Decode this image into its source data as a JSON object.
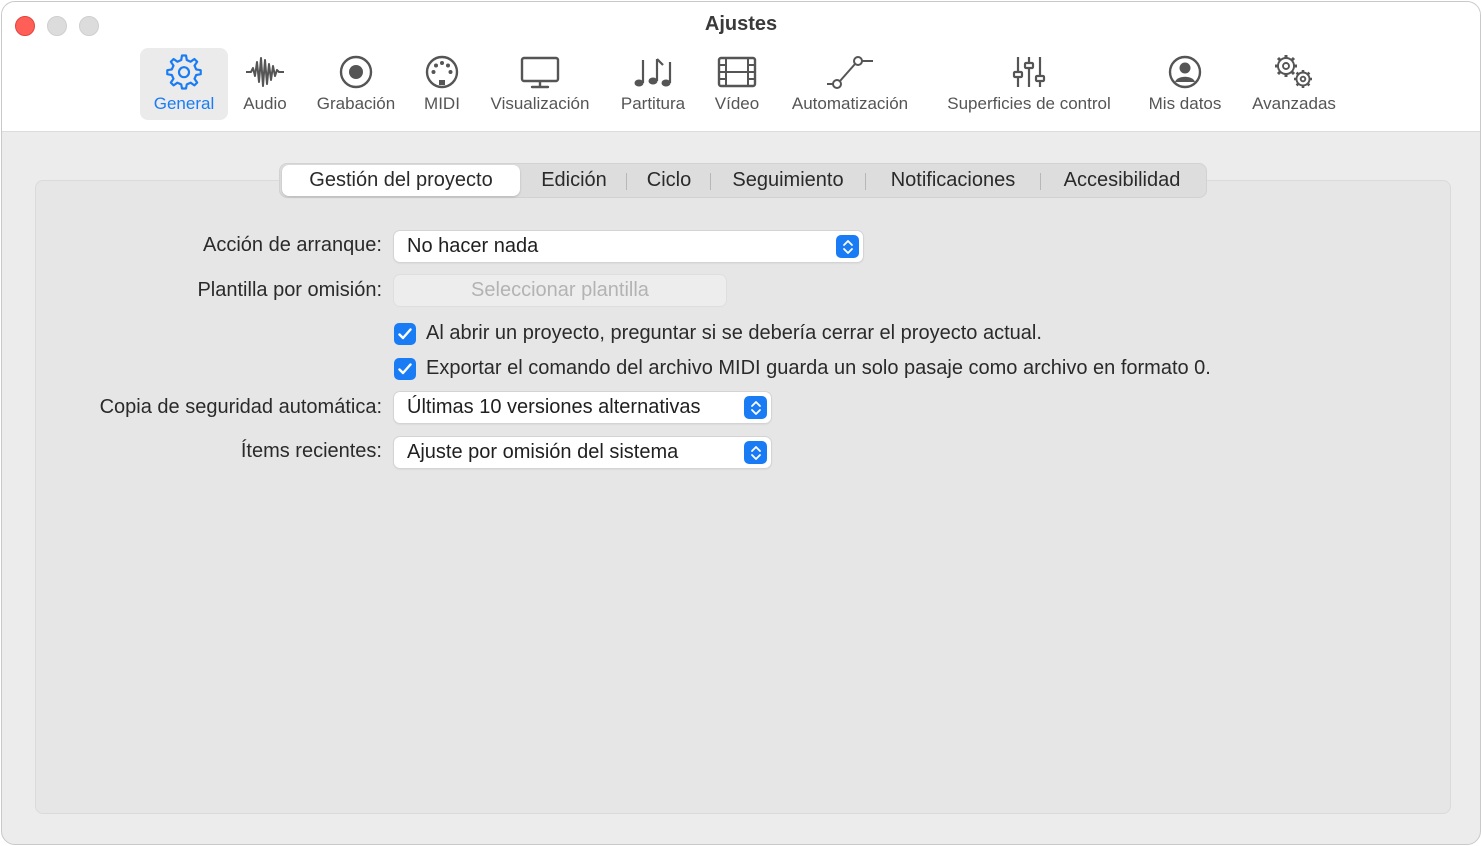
{
  "window": {
    "title": "Ajustes"
  },
  "toolbar": {
    "items": [
      {
        "label": "General",
        "icon": "gear-icon",
        "active": true
      },
      {
        "label": "Audio",
        "icon": "waveform-icon"
      },
      {
        "label": "Grabación",
        "icon": "record-icon"
      },
      {
        "label": "MIDI",
        "icon": "midi-icon"
      },
      {
        "label": "Visualización",
        "icon": "display-icon"
      },
      {
        "label": "Partitura",
        "icon": "music-notes-icon"
      },
      {
        "label": "Vídeo",
        "icon": "film-icon"
      },
      {
        "label": "Automatización",
        "icon": "automation-icon"
      },
      {
        "label": "Superficies de control",
        "icon": "sliders-icon"
      },
      {
        "label": "Mis datos",
        "icon": "person-icon"
      },
      {
        "label": "Avanzadas",
        "icon": "gears-icon"
      }
    ]
  },
  "tabs": [
    {
      "label": "Gestión del proyecto",
      "active": true
    },
    {
      "label": "Edición"
    },
    {
      "label": "Ciclo"
    },
    {
      "label": "Seguimiento"
    },
    {
      "label": "Notificaciones"
    },
    {
      "label": "Accesibilidad"
    }
  ],
  "settings": {
    "startup_action": {
      "label": "Acción de arranque:",
      "value": "No hacer nada"
    },
    "default_template": {
      "label": "Plantilla por omisión:",
      "button": "Seleccionar plantilla",
      "enabled": false
    },
    "checkboxes": [
      {
        "label": "Al abrir un proyecto, preguntar si se debería cerrar el proyecto actual.",
        "checked": true
      },
      {
        "label": "Exportar el comando del archivo MIDI guarda un solo pasaje como archivo en formato 0.",
        "checked": true
      }
    ],
    "auto_backup": {
      "label": "Copia de seguridad automática:",
      "value": "Últimas 10 versiones alternativas"
    },
    "recent_items": {
      "label": "Ítems recientes:",
      "value": "Ajuste por omisión del sistema"
    }
  },
  "colors": {
    "accent": "#1a7cf5",
    "close": "#ff5f57"
  }
}
